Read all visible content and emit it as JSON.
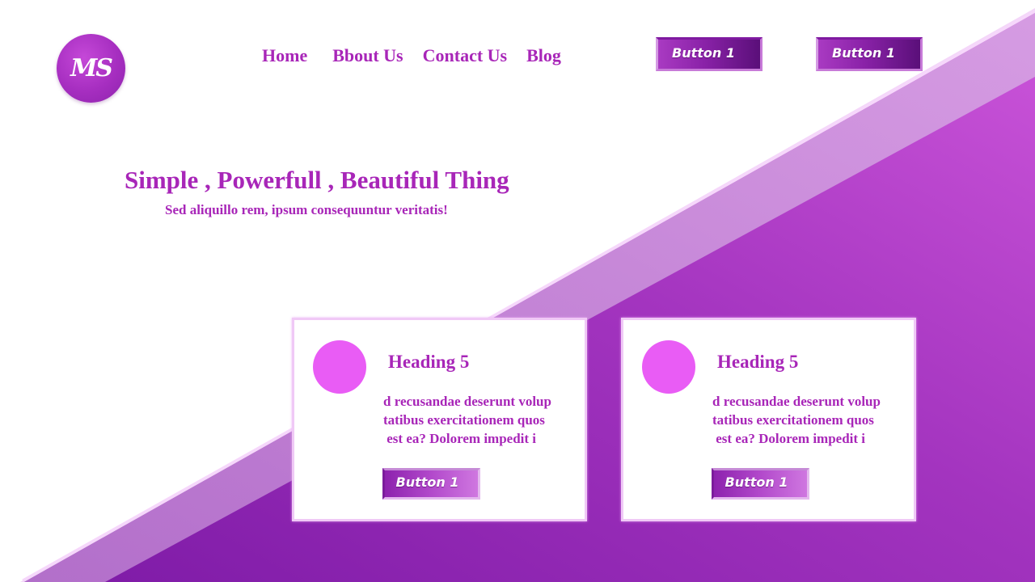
{
  "logo": {
    "text": "MS"
  },
  "nav": {
    "items": [
      {
        "label": "Home"
      },
      {
        "label": "Bbout Us"
      },
      {
        "label": "Contact Us"
      },
      {
        "label": "Blog"
      }
    ]
  },
  "header_buttons": [
    {
      "label": "Button 1"
    },
    {
      "label": "Button 1"
    }
  ],
  "hero": {
    "title": "Simple , Powerfull , Beautiful Thing",
    "subtitle": "Sed aliquillo rem, ipsum consequuntur veritatis!"
  },
  "cards": [
    {
      "heading": "Heading 5",
      "body": "d recusandae deserunt volup\ntatibus exercitationem quos\n est ea? Dolorem impedit i",
      "button": "Button 1"
    },
    {
      "heading": "Heading 5",
      "body": "d recusandae deserunt volup\ntatibus exercitationem quos\n est ea? Dolorem impedit i",
      "button": "Button 1"
    }
  ],
  "colors": {
    "accent": "#a826b8",
    "background_gradient_start": "#8a23b0",
    "background_gradient_end": "#c84fd8",
    "card_circle": "#e95cf5"
  }
}
